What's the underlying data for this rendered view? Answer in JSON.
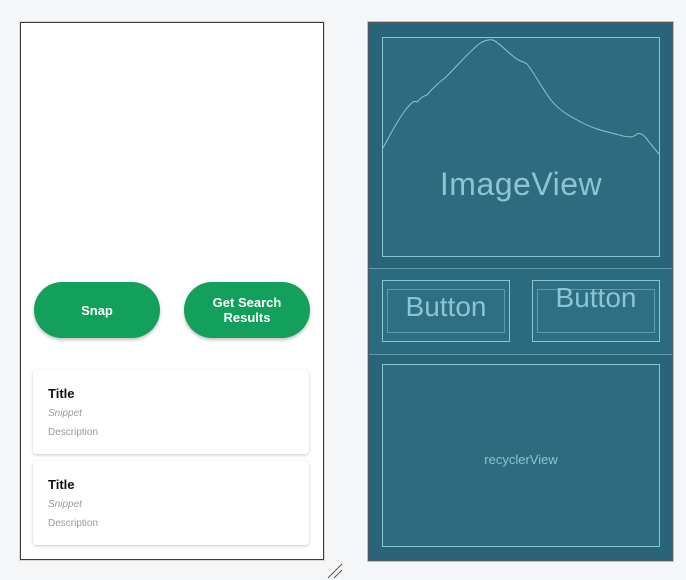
{
  "design": {
    "buttons": [
      {
        "label": "Snap"
      },
      {
        "label": "Get Search Results"
      }
    ],
    "cards": [
      {
        "title": "Title",
        "snippet": "Snippet",
        "description": "Description"
      },
      {
        "title": "Title",
        "snippet": "Snippet",
        "description": "Description"
      }
    ]
  },
  "blueprint": {
    "image_label": "ImageView",
    "button_labels": [
      "Button",
      "Button"
    ],
    "recycler_label": "recyclerView"
  },
  "icons": {
    "image_placeholder": "mountain-placeholder-icon",
    "resize": "resize-grip-icon"
  },
  "colors": {
    "button_green": "#12a05a",
    "blueprint_bg": "#2a6478",
    "blueprint_line": "#8dc4d2"
  }
}
